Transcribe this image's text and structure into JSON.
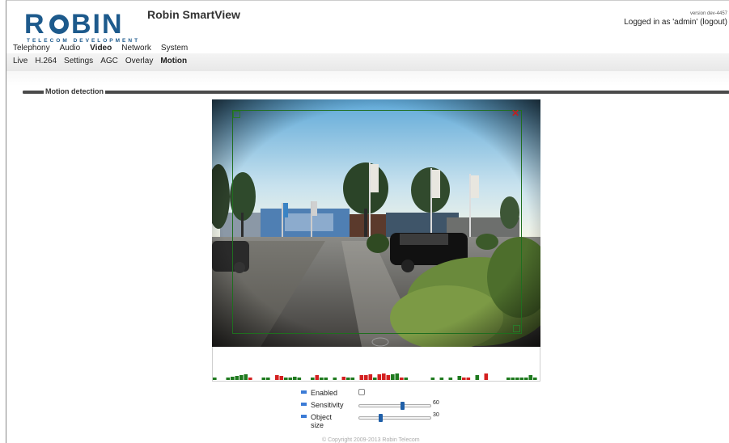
{
  "header": {
    "logo_text": "ROBIN",
    "logo_subtext": "TELECOM DEVELOPMENT",
    "app_title": "Robin SmartView",
    "version": "version dev-4457",
    "login_text": "Logged in as 'admin'",
    "logout_label": "(logout)"
  },
  "nav": {
    "main": [
      "Telephony",
      "Audio",
      "Video",
      "Network",
      "System"
    ],
    "main_active": "Video",
    "sub": [
      "Live",
      "H.264",
      "Settings",
      "AGC",
      "Overlay",
      "Motion"
    ],
    "sub_active": "Motion"
  },
  "section": {
    "title": "Motion detection"
  },
  "camera": {
    "close_icon": "close-icon",
    "detect_color": "#1f6e1f"
  },
  "activity": {
    "colors": {
      "motion": "#d42020",
      "idle": "#1f7a1f"
    }
  },
  "controls": {
    "enabled": {
      "label": "Enabled",
      "checked": false
    },
    "sensitivity": {
      "label": "Sensitivity",
      "value": "60",
      "fraction": 0.6
    },
    "object_size": {
      "label": "Object size",
      "value": "30",
      "fraction": 0.3
    }
  },
  "footer": {
    "copyright": "© Copyright 2009-2013 Robin Telecom"
  }
}
